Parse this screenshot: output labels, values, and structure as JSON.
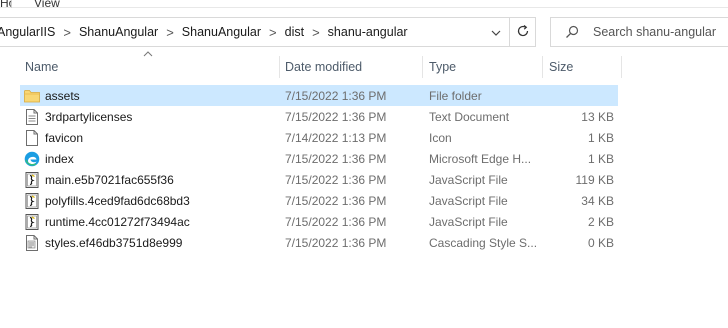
{
  "ribbon": {
    "tabs": [
      "Home",
      "View"
    ]
  },
  "address_bar": {
    "crumbs": [
      "AngularIIS",
      "ShanuAngular",
      "ShanuAngular",
      "dist",
      "shanu-angular"
    ],
    "separator": ">"
  },
  "search": {
    "placeholder": "Search shanu-angular"
  },
  "columns": {
    "name": "Name",
    "date_modified": "Date modified",
    "type": "Type",
    "size": "Size"
  },
  "files": [
    {
      "name": "assets",
      "date": "7/15/2022 1:36 PM",
      "type": "File folder",
      "size": "",
      "icon": "folder-icon",
      "selected": true
    },
    {
      "name": "3rdpartylicenses",
      "date": "7/15/2022 1:36 PM",
      "type": "Text Document",
      "size": "13 KB",
      "icon": "text-document-icon",
      "selected": false
    },
    {
      "name": "favicon",
      "date": "7/14/2022 1:13 PM",
      "type": "Icon",
      "size": "1 KB",
      "icon": "blank-file-icon",
      "selected": false
    },
    {
      "name": "index",
      "date": "7/15/2022 1:36 PM",
      "type": "Microsoft Edge H...",
      "size": "1 KB",
      "icon": "edge-icon",
      "selected": false
    },
    {
      "name": "main.e5b7021fac655f36",
      "date": "7/15/2022 1:36 PM",
      "type": "JavaScript File",
      "size": "119 KB",
      "icon": "javascript-file-icon",
      "selected": false
    },
    {
      "name": "polyfills.4ced9fad6dc68bd3",
      "date": "7/15/2022 1:36 PM",
      "type": "JavaScript File",
      "size": "34 KB",
      "icon": "javascript-file-icon",
      "selected": false
    },
    {
      "name": "runtime.4cc01272f73494ac",
      "date": "7/15/2022 1:36 PM",
      "type": "JavaScript File",
      "size": "2 KB",
      "icon": "javascript-file-icon",
      "selected": false
    },
    {
      "name": "styles.ef46db3751d8e999",
      "date": "7/15/2022 1:36 PM",
      "type": "Cascading Style S...",
      "size": "0 KB",
      "icon": "css-file-icon",
      "selected": false
    }
  ],
  "colors": {
    "selection": "#cce8ff",
    "folder": "#f8d775",
    "edge": "#1b9de2"
  }
}
